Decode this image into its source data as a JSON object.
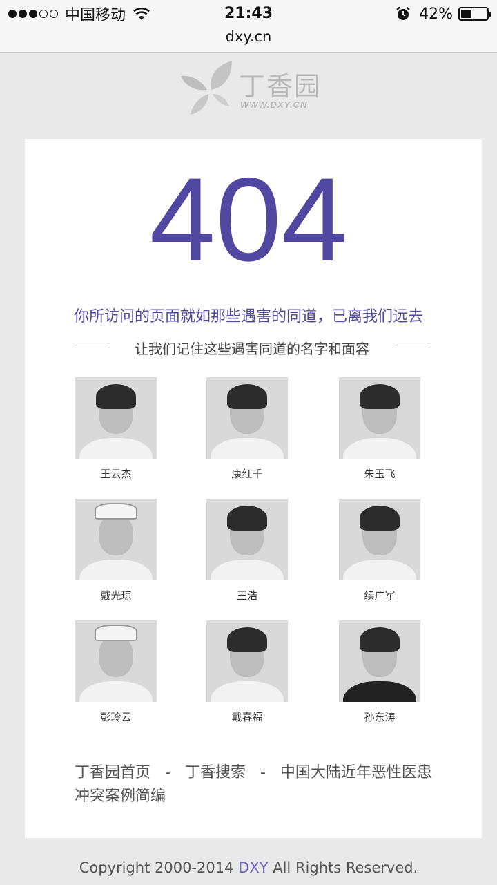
{
  "status_bar": {
    "carrier": "中国移动",
    "time": "21:43",
    "battery": "42%",
    "battery_level": 0.42
  },
  "url_bar": {
    "domain": "dxy.cn"
  },
  "logo": {
    "name_cn": "丁香园",
    "name_en": "WWW.DXY.CN",
    "color": "#b8b8b8"
  },
  "error": {
    "code": "404",
    "headline": "你所访问的页面就如那些遇害的同道，已离我们远去",
    "subline": "让我们记住这些遇害同道的名字和面容",
    "accent_color": "#5048a0"
  },
  "people": [
    {
      "name": "王云杰"
    },
    {
      "name": "康红千"
    },
    {
      "name": "朱玉飞"
    },
    {
      "name": "戴光琼"
    },
    {
      "name": "王浩"
    },
    {
      "name": "续广军"
    },
    {
      "name": "彭玲云"
    },
    {
      "name": "戴春福"
    },
    {
      "name": "孙东涛"
    }
  ],
  "footer": {
    "link_home": "丁香园首页",
    "separator": "-",
    "link_search": "丁香搜索",
    "link_cases": "中国大陆近年恶性医患冲突案例简编"
  },
  "copyright": {
    "prefix": "Copyright 2000-2014",
    "brand": "DXY",
    "suffix": "All Rights Reserved."
  }
}
